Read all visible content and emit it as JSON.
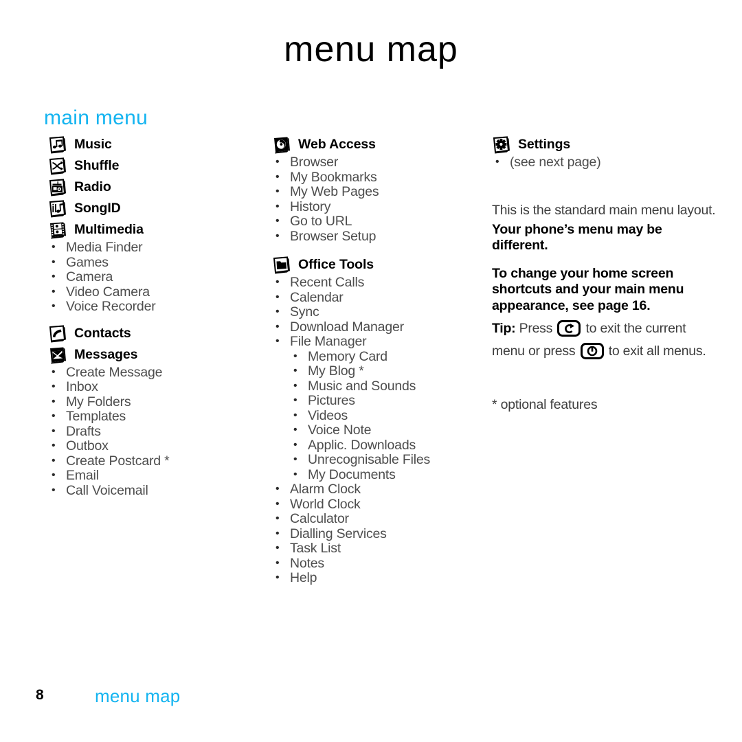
{
  "page": {
    "title": "menu map",
    "section_heading": "main menu",
    "footer_page_number": "8",
    "footer_label": "menu map",
    "accent_color": "#14b4f0",
    "text_color": "#4d4d4d"
  },
  "columns": {
    "left": [
      {
        "icon": "music-note-icon",
        "title": "Music",
        "items": []
      },
      {
        "icon": "shuffle-icon",
        "title": "Shuffle",
        "items": []
      },
      {
        "icon": "radio-icon",
        "title": "Radio",
        "items": []
      },
      {
        "icon": "songid-icon",
        "title": "SongID",
        "items": []
      },
      {
        "icon": "filmstrip-icon",
        "title": "Multimedia",
        "items": [
          "Media Finder",
          "Games",
          "Camera",
          "Video Camera",
          "Voice Recorder"
        ]
      },
      {
        "icon": "phone-handset-icon",
        "title": "Contacts",
        "items": []
      },
      {
        "icon": "envelope-icon",
        "title": "Messages",
        "items": [
          "Create Message",
          "Inbox",
          "My Folders",
          "Templates",
          "Drafts",
          "Outbox",
          "Create Postcard *",
          "Email",
          "Call Voicemail"
        ]
      }
    ],
    "middle": [
      {
        "icon": "globe-web-icon",
        "title": "Web Access",
        "items": [
          "Browser",
          "My Bookmarks",
          "My Web Pages",
          "History",
          "Go to URL",
          "Browser Setup"
        ]
      },
      {
        "icon": "folder-icon",
        "title": "Office Tools",
        "items": [
          "Recent Calls",
          "Calendar",
          "Sync",
          "Download Manager",
          "File Manager"
        ],
        "file_manager_subitems": [
          "Memory Card",
          "My Blog *",
          "Music and Sounds",
          "Pictures",
          "Videos",
          "Voice Note",
          "Applic. Downloads",
          "Unrecognisable Files",
          "My Documents"
        ],
        "items_after": [
          "Alarm Clock",
          "World Clock",
          "Calculator",
          "Dialling Services",
          "Task List",
          "Notes",
          "Help"
        ]
      }
    ],
    "right": [
      {
        "icon": "gear-icon",
        "title": "Settings",
        "items": [
          "(see next page)"
        ]
      }
    ]
  },
  "notes": {
    "standard_layout_line": "This is the standard main menu layout.",
    "bold_line_1": "Your phone’s menu may be",
    "bold_line_2": "different.",
    "bold_para_line_1": "To change your home screen",
    "bold_para_line_2": "shortcuts and your main menu",
    "bold_para_line_3": "appearance, see page 16.",
    "tip_label": "Tip:",
    "tip_text_1": "Press",
    "tip_icon_1": "back-key-icon",
    "tip_text_2": "to exit the current",
    "tip_text_3": "menu or press",
    "tip_icon_2": "power-key-icon",
    "tip_text_4": "to exit all menus.",
    "optional_note": "* optional features"
  }
}
